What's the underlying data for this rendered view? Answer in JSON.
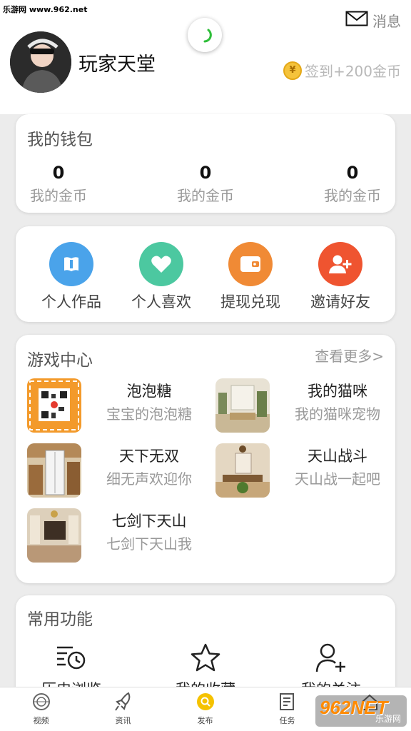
{
  "watermark_top": "乐游网 www.962.net",
  "header": {
    "username": "玩家天堂",
    "messages_label": "消息",
    "signin_label": "签到+200金币"
  },
  "wallet": {
    "title": "我的钱包",
    "stats": [
      {
        "value": "0",
        "label": "我的金币"
      },
      {
        "value": "0",
        "label": "我的金币"
      },
      {
        "value": "0",
        "label": "我的金币"
      }
    ]
  },
  "actions": [
    {
      "label": "个人作品",
      "icon": "book-icon",
      "color": "#4aa3ea"
    },
    {
      "label": "个人喜欢",
      "icon": "heart-icon",
      "color": "#4cc8a0"
    },
    {
      "label": "提现兑现",
      "icon": "wallet-icon",
      "color": "#f08a35"
    },
    {
      "label": "邀请好友",
      "icon": "add-user-icon",
      "color": "#ef5430"
    }
  ],
  "games": {
    "title": "游戏中心",
    "more": "查看更多>",
    "items": [
      {
        "name": "泡泡糖",
        "desc": "宝宝的泡泡糖"
      },
      {
        "name": "我的猫咪",
        "desc": "我的猫咪宠物"
      },
      {
        "name": "天下无双",
        "desc": "细无声欢迎你"
      },
      {
        "name": "天山战斗",
        "desc": "天山战一起吧"
      },
      {
        "name": "七剑下天山",
        "desc": "七剑下天山我"
      }
    ]
  },
  "functions": {
    "title": "常用功能",
    "items": [
      {
        "label": "历史浏览",
        "icon": "history-icon"
      },
      {
        "label": "我的收藏",
        "icon": "star-icon"
      },
      {
        "label": "我的关注",
        "icon": "follow-icon"
      }
    ]
  },
  "tabbar": [
    {
      "label": "视频",
      "icon": "video-icon"
    },
    {
      "label": "资讯",
      "icon": "rocket-icon"
    },
    {
      "label": "发布",
      "icon": "publish-icon"
    },
    {
      "label": "任务",
      "icon": "task-icon"
    },
    {
      "label": "",
      "icon": "home-icon"
    }
  ],
  "watermark_br": {
    "big": "962NET",
    "small": "乐游网"
  },
  "colors": {
    "accent_publish": "#f5c200",
    "coin": "#f5c33b"
  }
}
